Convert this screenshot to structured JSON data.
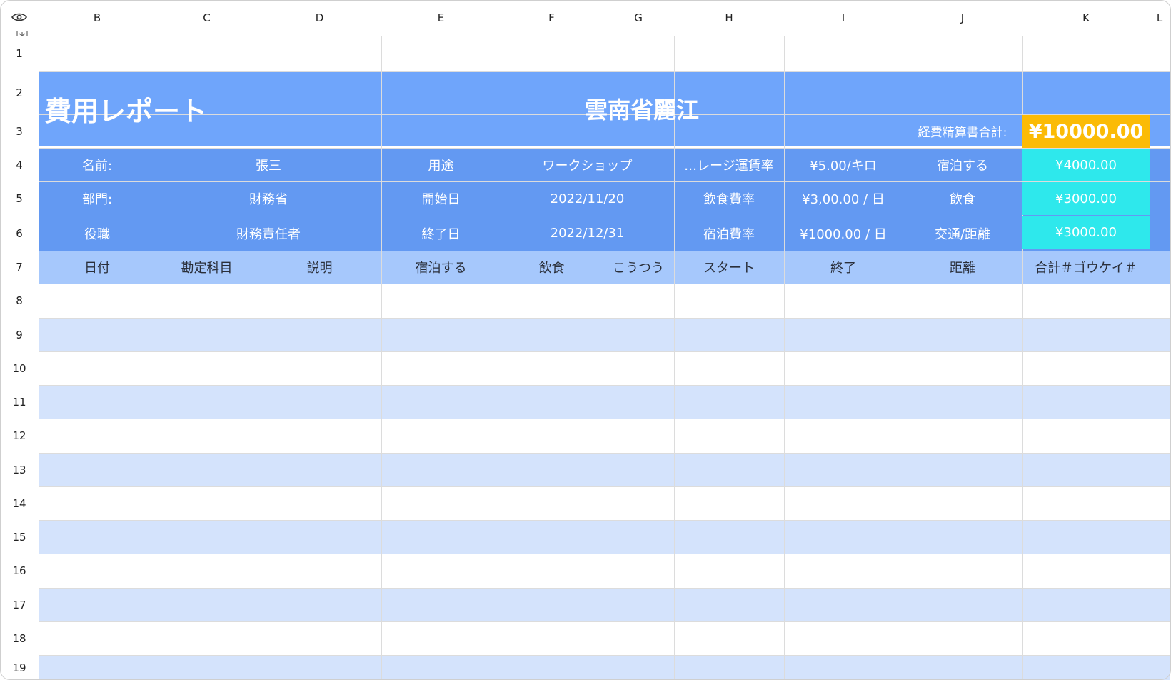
{
  "column_headers": [
    "B",
    "C",
    "D",
    "E",
    "F",
    "G",
    "H",
    "I",
    "J",
    "K",
    "L"
  ],
  "row_headers": [
    "1",
    "2",
    "3",
    "4",
    "5",
    "6",
    "7",
    "8",
    "9",
    "10",
    "11",
    "12",
    "13",
    "14",
    "15",
    "16",
    "17",
    "18",
    "19"
  ],
  "icons": {
    "corner_top": "eye-icon",
    "corner_bottom": "freeze-icon"
  },
  "colors": {
    "banner": "#6fa5fb",
    "banner_dark": "#6399f2",
    "header_row": "#a6c8fc",
    "stripe": "#d4e3fc",
    "total_value": "#fbbb06",
    "cyan": "#2ee8ec"
  },
  "report": {
    "title": "費用レポート",
    "city": "雲南省麗江",
    "total_label": "経費精算書合計:",
    "total_value": "¥10000.00"
  },
  "info": {
    "name_label": "名前:",
    "name_value": "張三",
    "dept_label": "部門:",
    "dept_value": "財務省",
    "role_label": "役職",
    "role_value": "財務責任者",
    "purpose_label": "用途",
    "purpose_value": "ワークショップ",
    "start_label": "開始日",
    "start_value": "2022/11/20",
    "end_label": "終了日",
    "end_value": "2022/12/31",
    "mileage_label": "…レージ運賃率",
    "mileage_value": "¥5.00/キロ",
    "meal_rate_label": "飲食費率",
    "meal_rate_value": "¥3,00.00 / 日",
    "lodging_rate_label": "宿泊費率",
    "lodging_rate_value": "¥1000.00 / 日",
    "lodging_label": "宿泊する",
    "lodging_total": "¥4000.00",
    "meal_label": "飲食",
    "meal_total": "¥3000.00",
    "transport_label": "交通/距離",
    "transport_total": "¥3000.00"
  },
  "table_headers": [
    "日付",
    "勘定科目",
    "説明",
    "宿泊する",
    "飲食",
    "こうつう",
    "スタート",
    "終了",
    "距離",
    "合計＃ゴウケイ＃"
  ]
}
